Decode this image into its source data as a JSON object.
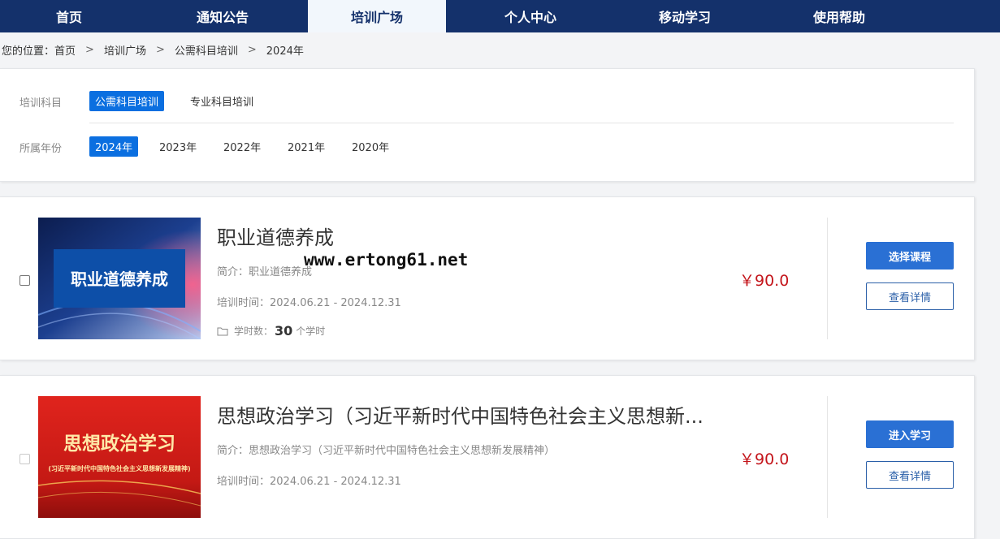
{
  "nav": {
    "items": [
      {
        "label": "首页"
      },
      {
        "label": "通知公告"
      },
      {
        "label": "培训广场"
      },
      {
        "label": "个人中心"
      },
      {
        "label": "移动学习"
      },
      {
        "label": "使用帮助"
      }
    ],
    "active": "培训广场"
  },
  "breadcrumb": {
    "prefix": "您的位置：",
    "items": [
      "首页",
      "培训广场",
      "公需科目培训",
      "2024年"
    ],
    "separator": ">"
  },
  "filters": {
    "subject_label": "培训科目",
    "subjects": [
      "公需科目培训",
      "专业科目培训"
    ],
    "subject_selected": "公需科目培训",
    "year_label": "所属年份",
    "years": [
      "2024年",
      "2023年",
      "2022年",
      "2021年",
      "2020年"
    ],
    "year_selected": "2024年"
  },
  "courses": [
    {
      "thumb_text": "职业道德养成",
      "title": "职业道德养成",
      "intro": "简介：职业道德养成",
      "time": "培训时间：2024.06.21 - 2024.12.31",
      "hours_label": "学时数：",
      "hours": "30",
      "hours_unit": "个学时",
      "price": "￥90.0",
      "primary_button": "选择课程",
      "detail_button": "查看详情",
      "checkbox_enabled": true
    },
    {
      "thumb_text": "思想政治学习",
      "thumb_subtext": "(习近平新时代中国特色社会主义思想新发展精神)",
      "title": "思想政治学习（习近平新时代中国特色社会主义思想新...",
      "intro": "简介：思想政治学习（习近平新时代中国特色社会主义思想新发展精神）",
      "time": "培训时间：2024.06.21 - 2024.12.31",
      "price": "￥90.0",
      "primary_button": "进入学习",
      "detail_button": "查看详情",
      "checkbox_enabled": false
    }
  ],
  "watermark": "www.ertong61.net",
  "colors": {
    "nav_bg": "#14316b",
    "active_chip": "#0b6fe0",
    "price": "#c4161c",
    "primary_button": "#2a70d4"
  }
}
